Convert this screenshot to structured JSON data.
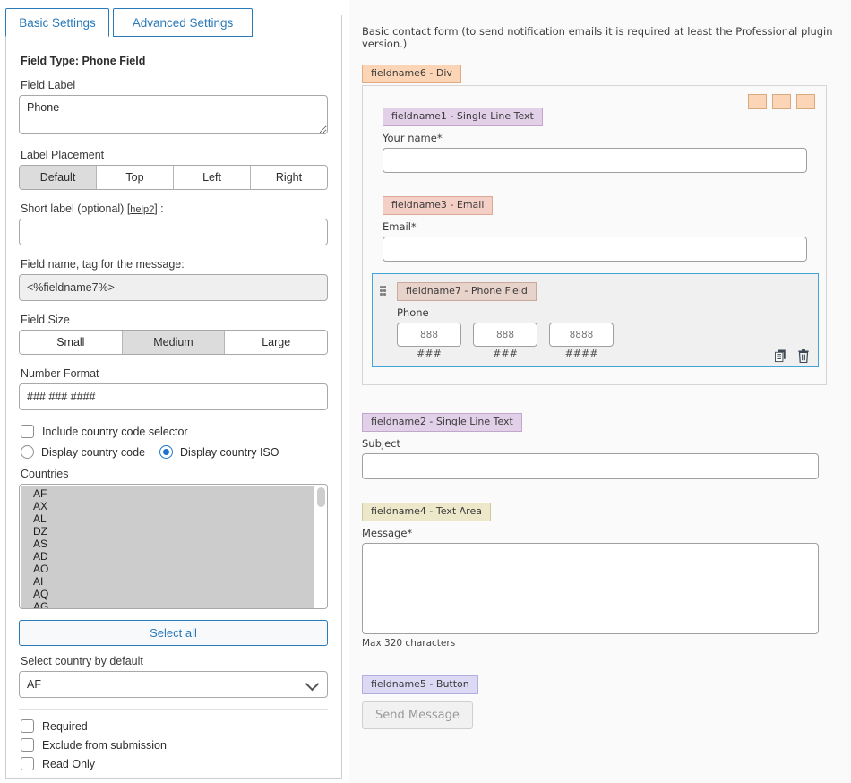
{
  "left": {
    "tabs": [
      {
        "label": "Basic Settings",
        "active": true
      },
      {
        "label": "Advanced Settings",
        "active": false
      }
    ],
    "field_type": "Field Type: Phone Field",
    "field_label_title": "Field Label",
    "field_label_value": "Phone",
    "label_placement_title": "Label Placement",
    "label_placement_options": [
      "Default",
      "Top",
      "Left",
      "Right"
    ],
    "label_placement_selected": "Default",
    "short_label_title": "Short label (optional) [",
    "short_label_help": "help?",
    "short_label_title_end": "] :",
    "short_label_value": "",
    "field_name_title": "Field name, tag for the message:",
    "field_name_value": "<%fieldname7%>",
    "field_size_title": "Field Size",
    "field_size_options": [
      "Small",
      "Medium",
      "Large"
    ],
    "field_size_selected": "Medium",
    "number_format_title": "Number Format",
    "number_format_value": "### ### ####",
    "include_country_code_label": "Include country code selector",
    "include_country_code_checked": false,
    "display_country_code_label": "Display country code",
    "display_country_iso_label": "Display country ISO",
    "display_mode_selected": "Display country ISO",
    "countries_title": "Countries",
    "countries": [
      "AF",
      "AX",
      "AL",
      "DZ",
      "AS",
      "AD",
      "AO",
      "AI",
      "AQ",
      "AG"
    ],
    "select_all_label": "Select all",
    "default_country_title": "Select country by default",
    "default_country_value": "AF",
    "required_label": "Required",
    "required_checked": false,
    "exclude_label": "Exclude from submission",
    "exclude_checked": false,
    "readonly_label": "Read Only",
    "readonly_checked": false
  },
  "right": {
    "form_note": "Basic contact form (to send notification emails it is required at least the Professional plugin version.)",
    "div_tag": "fieldname6 - Div",
    "name_tag": "fieldname1 - Single Line Text",
    "name_label": "Your name*",
    "name_value": "",
    "email_tag": "fieldname3 - Email",
    "email_label": "Email*",
    "email_value": "",
    "phone_tag": "fieldname7 - Phone Field",
    "phone_label": "Phone",
    "phone_parts": [
      {
        "placeholder": "888",
        "mask": "###"
      },
      {
        "placeholder": "888",
        "mask": "###"
      },
      {
        "placeholder": "8888",
        "mask": "####"
      }
    ],
    "subject_tag": "fieldname2 - Single Line Text",
    "subject_label": "Subject",
    "subject_value": "",
    "message_tag": "fieldname4 - Text Area",
    "message_label": "Message*",
    "message_value": "",
    "max_chars": "Max 320 characters",
    "button_tag": "fieldname5 - Button",
    "send_label": "Send Message"
  },
  "colors": {
    "accent_blue": "#2a7ab9",
    "selection_blue": "#41a5dc",
    "tag_div": "#fbd5b5",
    "tag_single_line": "#e2cfe8",
    "tag_email": "#f4cfc5",
    "tag_phone": "#e8d3cb",
    "tag_textarea": "#ece8c9",
    "tag_button": "#dcd9f5",
    "segment_active": "#dcdcdc",
    "list_selected": "#cccccc"
  }
}
